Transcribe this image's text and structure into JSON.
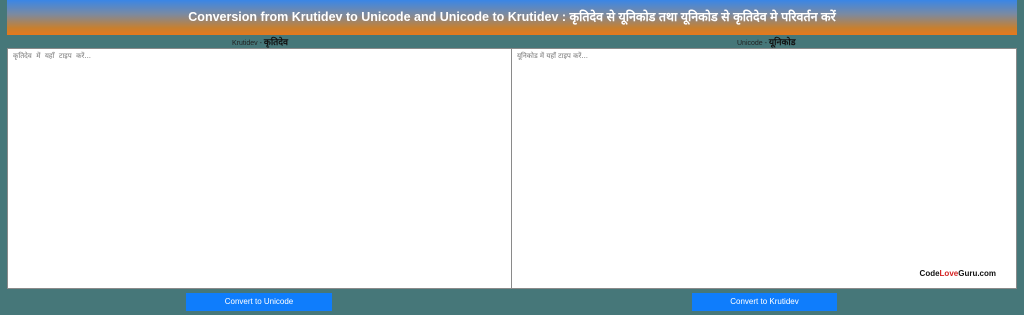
{
  "header": {
    "title": "Conversion from Krutidev to Unicode and Unicode to Krutidev : कृतिदेव से यूनिकोड तथा यूनिकोड से कृतिदेव मे परिवर्तन करें"
  },
  "left_pane": {
    "label_en": "Krutidev - ",
    "label_hi": "कृतिदेव",
    "placeholder": "कृतिदेव  में  यहाँ  टाइप  करें..."
  },
  "right_pane": {
    "label_en": "Unicode - ",
    "label_hi": "यूनिकोड",
    "placeholder": "यूनिकोड में यहाँ टाइप करें..."
  },
  "brand": {
    "part1": "Code",
    "part2": "Love",
    "part3": "Guru.com"
  },
  "buttons": {
    "to_unicode": "Convert to Unicode",
    "to_krutidev": "Convert to Krutidev"
  }
}
